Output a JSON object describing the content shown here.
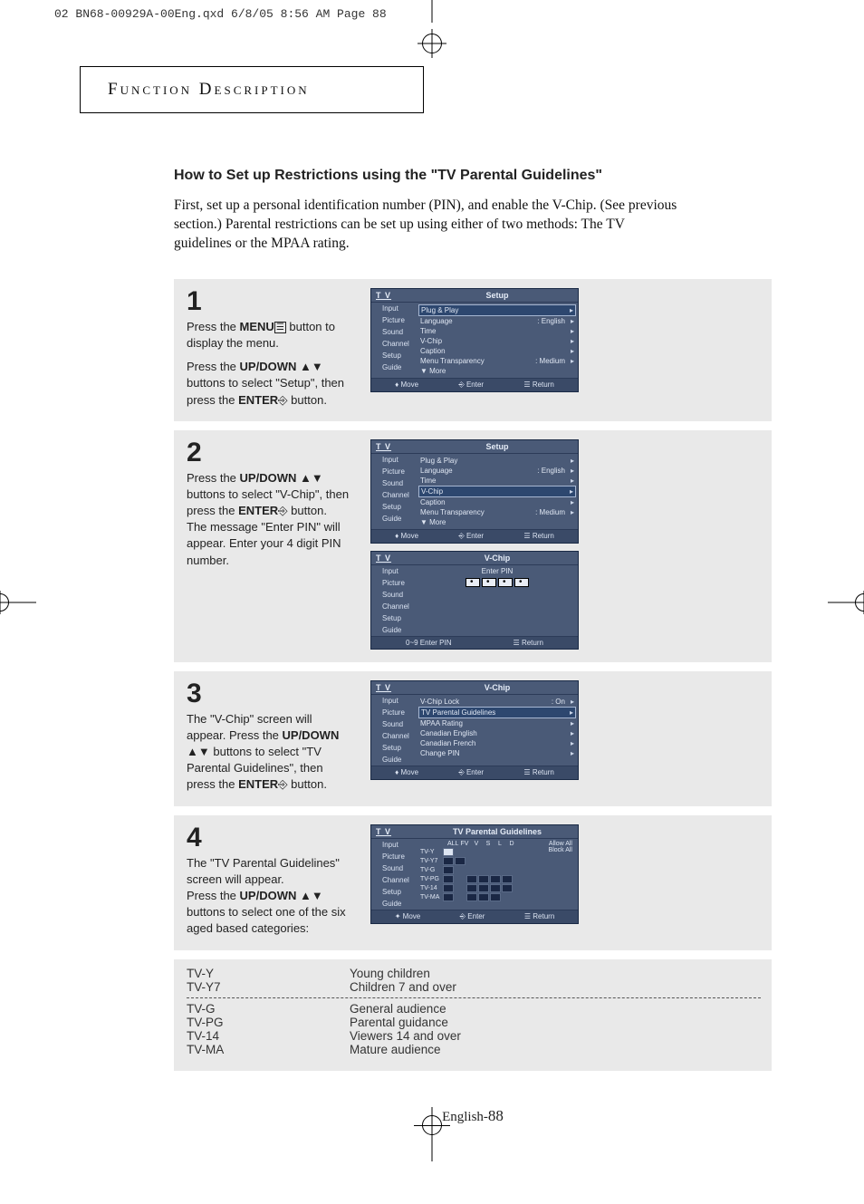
{
  "printHeader": "02 BN68-00929A-00Eng.qxd  6/8/05 8:56 AM  Page 88",
  "header": {
    "title": "Function Description"
  },
  "section": {
    "title": "How to Set up Restrictions using the \"TV Parental Guidelines\"",
    "intro": "First, set up a personal identification number (PIN), and enable the V-Chip. (See previous section.) Parental restrictions can be set up using either of two methods: The TV guidelines or the MPAA rating."
  },
  "steps": {
    "s1": {
      "num": "1",
      "t1a": "Press the ",
      "t1b": "MENU",
      "t1c": " button to display the menu.",
      "t2a": "Press the ",
      "t2b": "UP/DOWN",
      "t2c": " buttons to select \"Setup\", then press the ",
      "t2d": "ENTER",
      "t2e": " button."
    },
    "s2": {
      "num": "2",
      "t1a": "Press the ",
      "t1b": "UP/DOWN",
      "t1c": " buttons  to select \"V-Chip\", then press the ",
      "t1d": "ENTER",
      "t1e": " button.",
      "t2a": "The message \"Enter PIN\" will appear. Enter your 4 digit PIN number."
    },
    "s3": {
      "num": "3",
      "t1a": "The \"V-Chip\" screen will appear. Press the ",
      "t1b": "UP/DOWN",
      "t1c": "  buttons to select \"TV Parental Guidelines\", then press the ",
      "t1d": "ENTER",
      "t1e": "  button."
    },
    "s4": {
      "num": "4",
      "t1a": "The \"TV Parental Guidelines\" screen will appear.",
      "t2a": "Press the ",
      "t2b": "UP/DOWN",
      "t2c": " buttons to select one of the six aged based categories:"
    }
  },
  "osd": {
    "tvLabel": "T V",
    "nav": [
      "Input",
      "Picture",
      "Sound",
      "Channel",
      "Setup",
      "Guide"
    ],
    "setup": {
      "title": "Setup",
      "items": [
        {
          "lbl": "Plug & Play",
          "val": ""
        },
        {
          "lbl": "Language",
          "val": ": English"
        },
        {
          "lbl": "Time",
          "val": ""
        },
        {
          "lbl": "V-Chip",
          "val": ""
        },
        {
          "lbl": "Caption",
          "val": ""
        },
        {
          "lbl": "Menu Transparency",
          "val": ": Medium"
        },
        {
          "lbl": "▼ More",
          "val": ""
        }
      ]
    },
    "vchipEnter": {
      "title": "V-Chip",
      "enterPin": "Enter PIN",
      "footer": {
        "l": "0~9 Enter PIN",
        "r": "Return"
      }
    },
    "vchip": {
      "title": "V-Chip",
      "items": [
        {
          "lbl": "V-Chip Lock",
          "val": ": On"
        },
        {
          "lbl": "TV Parental Guidelines",
          "val": ""
        },
        {
          "lbl": "MPAA Rating",
          "val": ""
        },
        {
          "lbl": "Canadian English",
          "val": ""
        },
        {
          "lbl": "Canadian French",
          "val": ""
        },
        {
          "lbl": "Change PIN",
          "val": ""
        }
      ]
    },
    "tvpg": {
      "title": "TV Parental Guidelines",
      "cols": [
        "ALL",
        "FV",
        "V",
        "S",
        "L",
        "D"
      ],
      "rows": [
        "TV-Y",
        "TV-Y7",
        "TV-G",
        "TV-PG",
        "TV-14",
        "TV-MA"
      ],
      "allow": "Allow All",
      "block": "Block All"
    },
    "footer": {
      "move": "Move",
      "enter": "Enter",
      "return": "Return"
    }
  },
  "ratings": [
    {
      "code": "TV-Y",
      "desc": "Young children"
    },
    {
      "code": "TV-Y7",
      "desc": "Children 7 and over"
    },
    {
      "code": "TV-G",
      "desc": "General audience"
    },
    {
      "code": "TV-PG",
      "desc": "Parental guidance"
    },
    {
      "code": "TV-14",
      "desc": "Viewers 14 and over"
    },
    {
      "code": "TV-MA",
      "desc": "Mature audience"
    }
  ],
  "pageNum": {
    "lang": "English-",
    "num": "88"
  }
}
